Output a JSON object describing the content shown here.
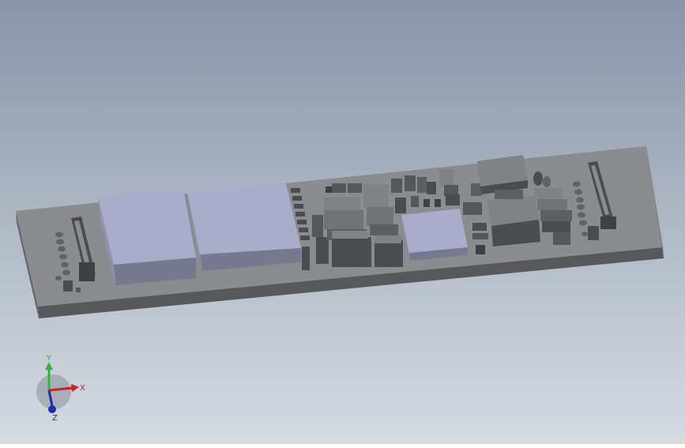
{
  "window": {
    "kind": "3d-model-viewport",
    "background_top": "#8795a8",
    "background_bottom": "#d6dbe2"
  },
  "model": {
    "board_top_color": "#8a8c90",
    "board_front_color": "#56585b",
    "board_side_color": "#66686b",
    "component_top_color": "#808286",
    "component_side_color": "#4a4c4f",
    "shield_top_color": "#a9adcb",
    "shield_side_color": "#777a8e"
  },
  "triad": {
    "x_label": "X",
    "y_label": "Y",
    "z_label": "Z",
    "x_color": "#c8232c",
    "y_color": "#2fb53c",
    "z_color": "#1c2fa8"
  }
}
